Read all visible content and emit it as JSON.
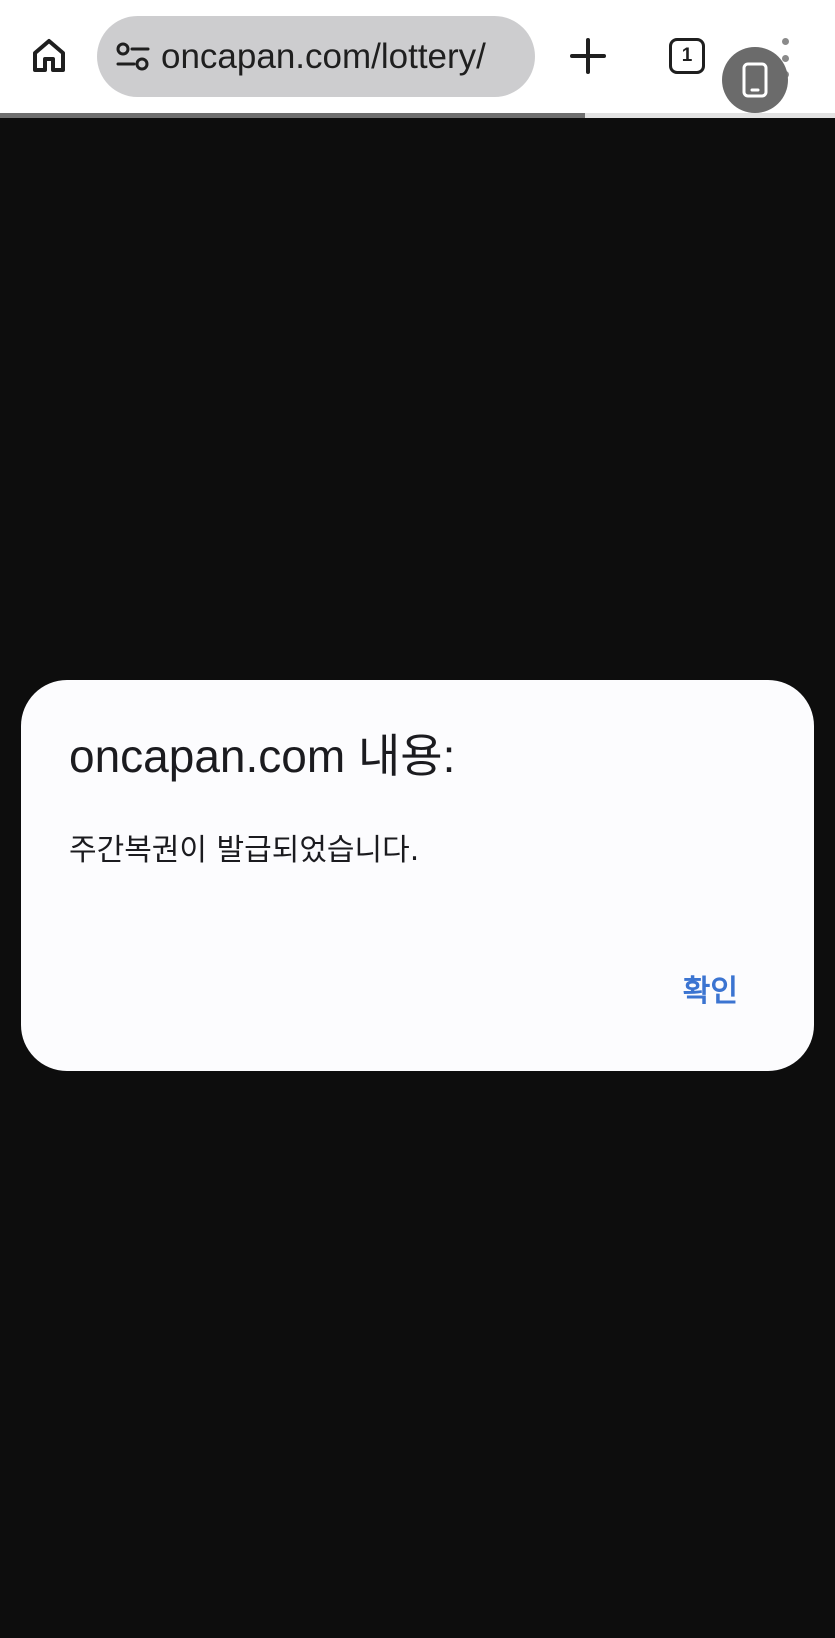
{
  "browser": {
    "url": "oncapan.com/lottery/",
    "tab_count": "1",
    "load_progress": 0.7,
    "icons": {
      "home": "home-icon",
      "site_settings": "tune-icon",
      "new_tab": "plus-icon",
      "tab_switcher": "tab-switcher-icon",
      "menu": "more-vert-icon",
      "bubble": "phone-icon"
    }
  },
  "dialog": {
    "title": "oncapan.com 내용:",
    "message": "주간복권이 발급되었습니다.",
    "confirm_label": "확인"
  },
  "colors": {
    "page_background": "#0d0d0d",
    "toolbar_background": "#ffffff",
    "omnibox_background": "#cdcdcf",
    "dialog_background": "#fcfcfe",
    "accent": "#3b74d1"
  }
}
